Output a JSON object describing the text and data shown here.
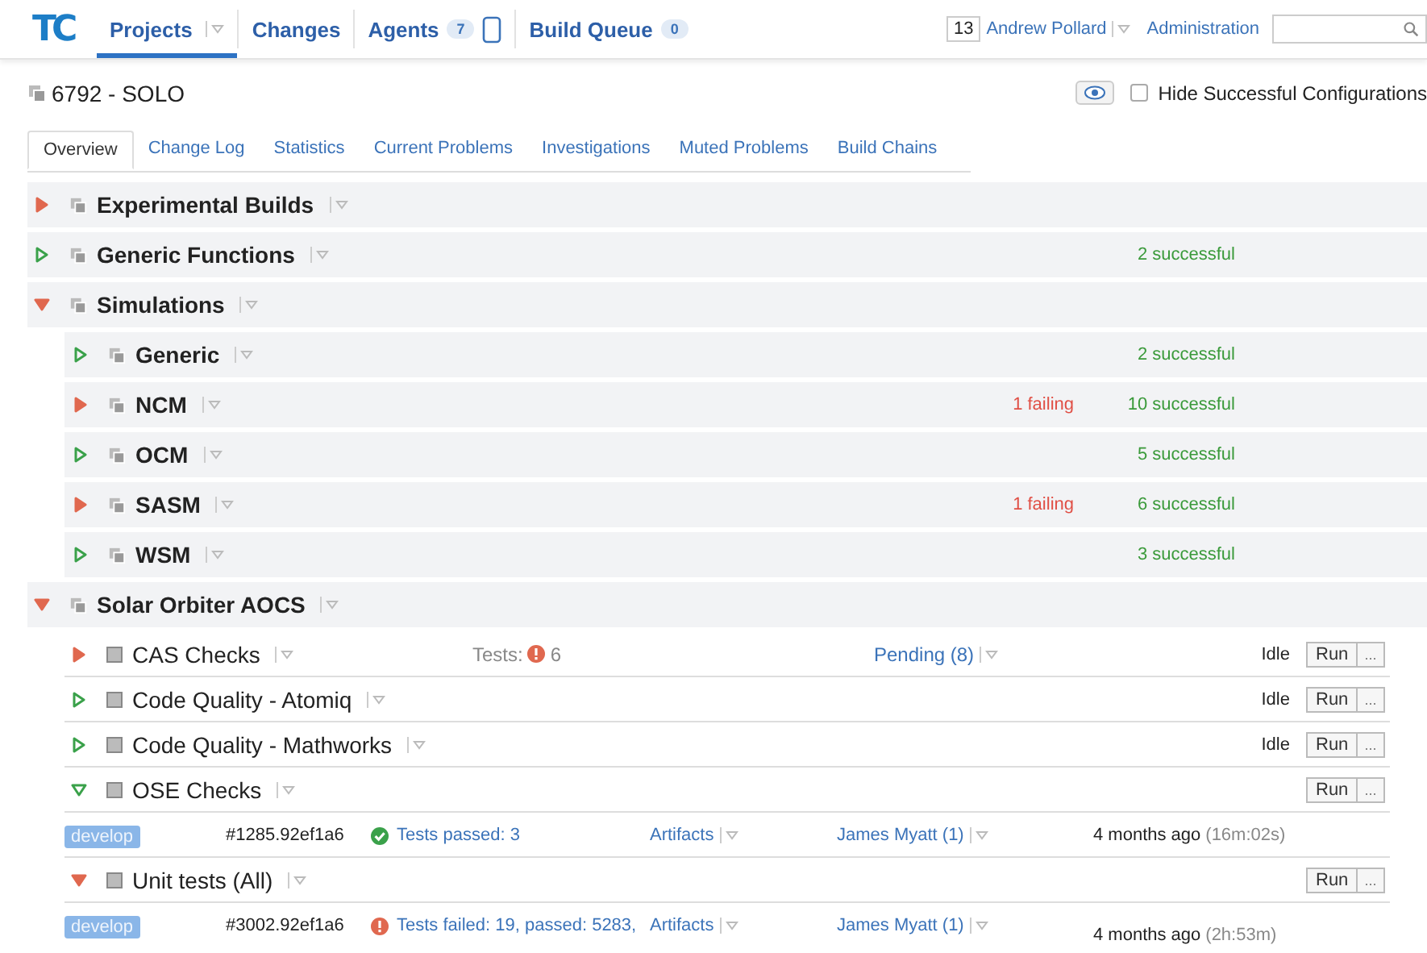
{
  "header": {
    "logo": "TC",
    "nav": [
      {
        "label": "Projects",
        "selected": true,
        "kind": "menu"
      },
      {
        "label": "Changes",
        "selected": false,
        "kind": "link"
      },
      {
        "label": "Agents",
        "selected": false,
        "kind": "agents",
        "badge": "7"
      },
      {
        "label": "Build Queue",
        "selected": false,
        "kind": "counter",
        "badge": "0"
      }
    ],
    "user": {
      "count": "13",
      "name": "Andrew Pollard"
    },
    "admin_link": "Administration"
  },
  "project": {
    "name": "6792 - SOLO",
    "hide_successful": {
      "label": "Hide Successful Configurations",
      "checked": false
    }
  },
  "tabs": [
    {
      "label": "Overview",
      "selected": true
    },
    {
      "label": "Change Log",
      "selected": false
    },
    {
      "label": "Statistics",
      "selected": false
    },
    {
      "label": "Current Problems",
      "selected": false
    },
    {
      "label": "Investigations",
      "selected": false
    },
    {
      "label": "Muted Problems",
      "selected": false
    },
    {
      "label": "Build Chains",
      "selected": false
    }
  ],
  "projects": [
    {
      "name": "Experimental Builds",
      "has_failures": true,
      "expanded": false
    },
    {
      "name": "Generic Functions",
      "has_failures": false,
      "expanded": false,
      "successful": "2 successful"
    },
    {
      "name": "Simulations",
      "has_failures": true,
      "expanded": true,
      "children": [
        {
          "name": "Generic",
          "has_failures": false,
          "expanded": false,
          "successful": "2 successful"
        },
        {
          "name": "NCM",
          "has_failures": true,
          "expanded": false,
          "failing": "1 failing",
          "successful": "10 successful"
        },
        {
          "name": "OCM",
          "has_failures": false,
          "expanded": false,
          "successful": "5 successful"
        },
        {
          "name": "SASM",
          "has_failures": true,
          "expanded": false,
          "failing": "1 failing",
          "successful": "6 successful"
        },
        {
          "name": "WSM",
          "has_failures": false,
          "expanded": false,
          "successful": "3 successful"
        }
      ]
    },
    {
      "name": "Solar Orbiter AOCS",
      "has_failures": true,
      "expanded": true,
      "configs": [
        {
          "name": "CAS Checks",
          "has_failures": true,
          "expanded": false,
          "tests_label": "Tests:",
          "tests_count": "6",
          "pending": "Pending (8)",
          "state": "Idle",
          "run": "Run",
          "more": "..."
        },
        {
          "name": "Code Quality - Atomiq",
          "has_failures": false,
          "expanded": false,
          "state": "Idle",
          "run": "Run",
          "more": "..."
        },
        {
          "name": "Code Quality - Mathworks",
          "has_failures": false,
          "expanded": false,
          "state": "Idle",
          "run": "Run",
          "more": "..."
        },
        {
          "name": "OSE Checks",
          "has_failures": false,
          "expanded": true,
          "run": "Run",
          "more": "...",
          "builds": [
            {
              "branch": "develop",
              "number": "#1285.92ef1a6",
              "passed": true,
              "tests": "Tests passed: 3",
              "artifacts": "Artifacts",
              "changes": "James Myatt (1)",
              "time": "4 months ago",
              "duration": "(16m:02s)"
            }
          ]
        },
        {
          "name": "Unit tests (All)",
          "has_failures": true,
          "expanded": true,
          "run": "Run",
          "more": "...",
          "builds": [
            {
              "branch": "develop",
              "number": "#3002.92ef1a6",
              "passed": false,
              "tests": "Tests failed: 19, passed: 5283,",
              "artifacts": "Artifacts",
              "changes": "James Myatt (1)",
              "time": "4 months ago",
              "duration": "(2h:53m)"
            }
          ]
        }
      ]
    }
  ]
}
